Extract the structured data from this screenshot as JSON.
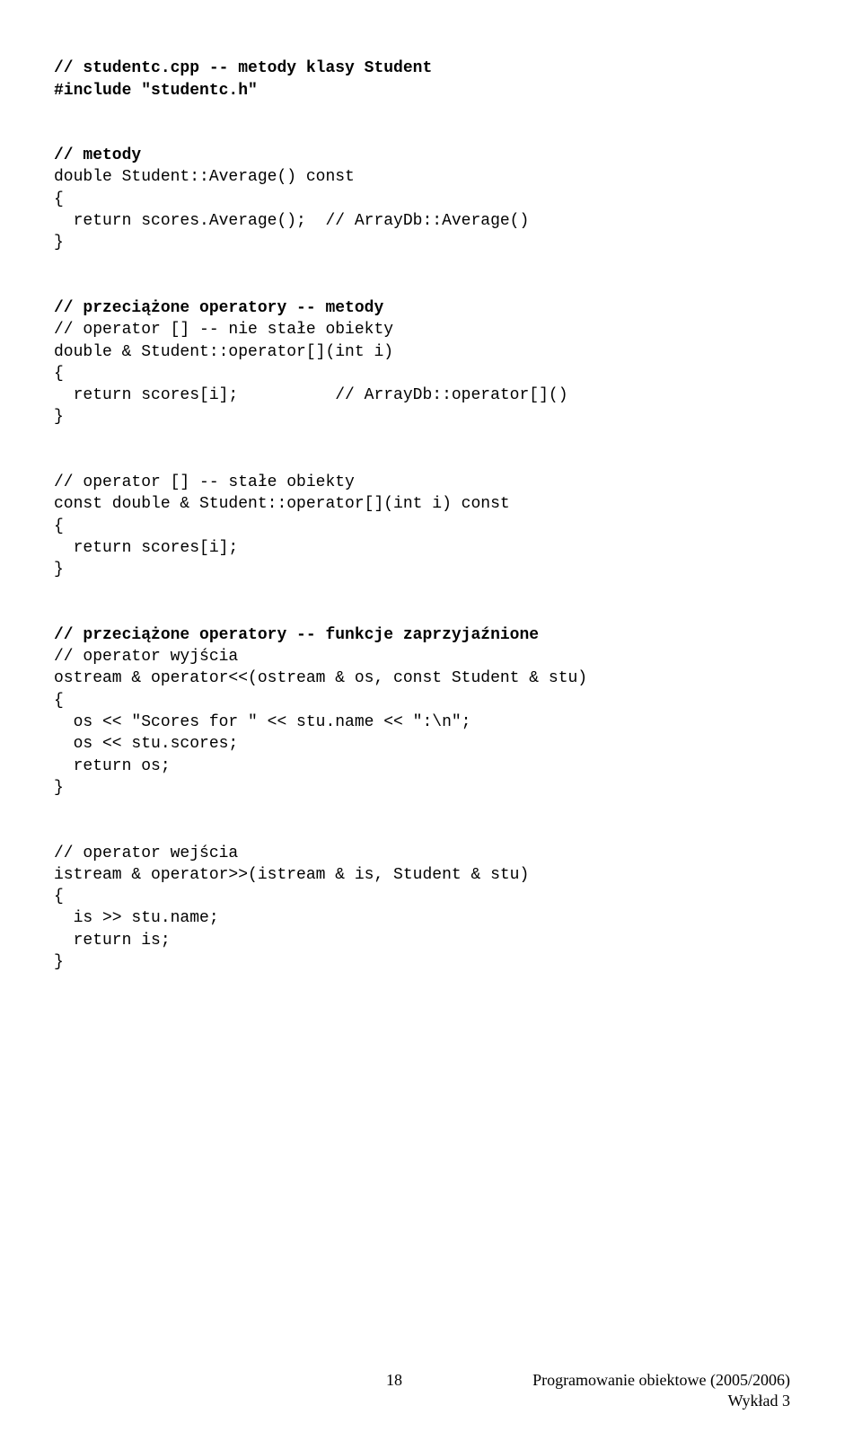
{
  "b1_l1": "// studentc.cpp -- metody klasy Student",
  "b1_l2": "#include \"studentc.h\"",
  "b2_l1": "// metody",
  "b2_l2": "double Student::Average() const",
  "b2_l3": "{",
  "b2_l4": "  return scores.Average();  // ArrayDb::Average()",
  "b2_l5": "}",
  "b3_l1": "// przeciążone operatory -- metody",
  "b3_l2": "// operator [] -- nie stałe obiekty",
  "b3_l3": "double & Student::operator[](int i)",
  "b3_l4": "{",
  "b3_l5": "  return scores[i];          // ArrayDb::operator[]()",
  "b3_l6": "}",
  "b4_l1": "// operator [] -- stałe obiekty",
  "b4_l2": "const double & Student::operator[](int i) const",
  "b4_l3": "{",
  "b4_l4": "  return scores[i];",
  "b4_l5": "}",
  "b5_l1": "// przeciążone operatory -- funkcje zaprzyjaźnione",
  "b5_l2": "// operator wyjścia",
  "b5_l3": "ostream & operator<<(ostream & os, const Student & stu)",
  "b5_l4": "{",
  "b5_l5": "  os << \"Scores for \" << stu.name << \":\\n\";",
  "b5_l6": "  os << stu.scores;",
  "b5_l7": "  return os;",
  "b5_l8": "}",
  "b6_l1": "// operator wejścia",
  "b6_l2": "istream & operator>>(istream & is, Student & stu)",
  "b6_l3": "{",
  "b6_l4": "  is >> stu.name;",
  "b6_l5": "  return is;",
  "b6_l6": "}",
  "footer": {
    "page": "18",
    "right1": "Programowanie obiektowe (2005/2006)",
    "right2": "Wykład 3"
  }
}
